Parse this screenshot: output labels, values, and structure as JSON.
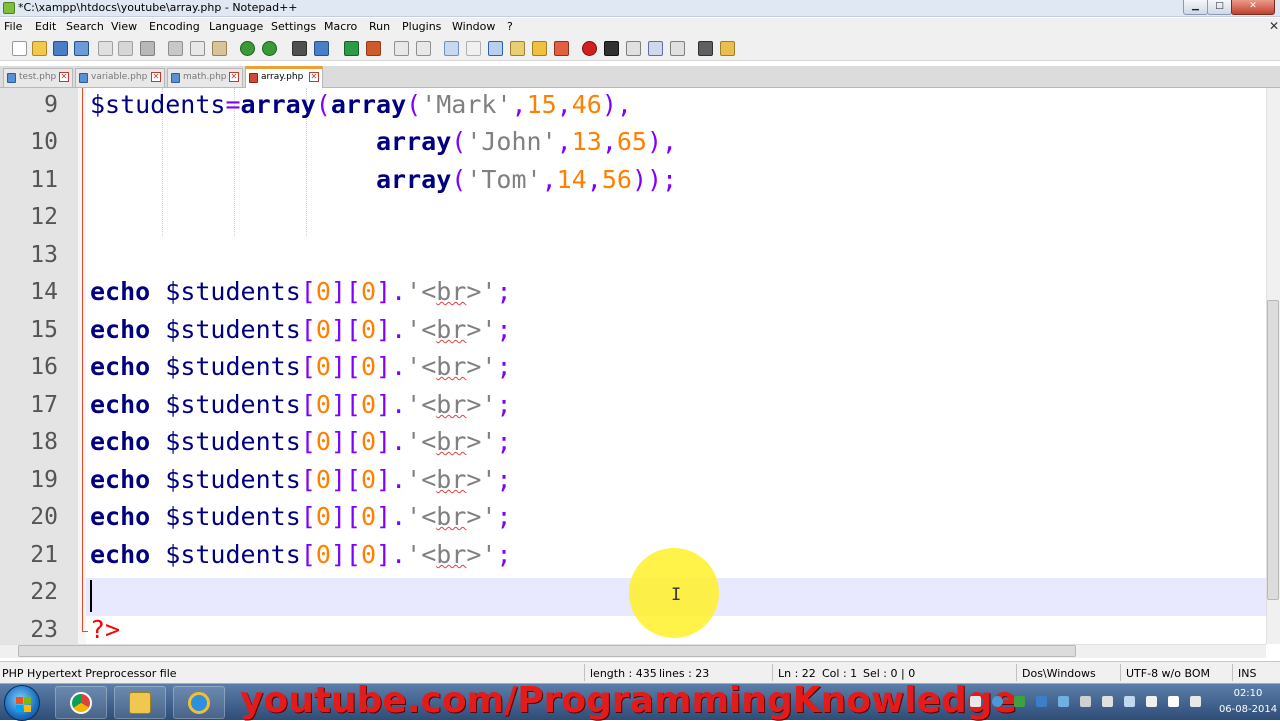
{
  "window": {
    "title": "*C:\\xampp\\htdocs\\youtube\\array.php - Notepad++",
    "min_glyph": "▁",
    "max_glyph": "□",
    "close_glyph": "✕"
  },
  "menu": {
    "items": [
      "File",
      "Edit",
      "Search",
      "View",
      "Encoding",
      "Language",
      "Settings",
      "Macro",
      "Run",
      "Plugins",
      "Window",
      "?"
    ],
    "close_glyph": "✕"
  },
  "tabs": [
    {
      "label": "test.php",
      "active": false
    },
    {
      "label": "variable.php",
      "active": false
    },
    {
      "label": "math.php",
      "active": false
    },
    {
      "label": "array.php",
      "active": true
    }
  ],
  "tab_close_glyph": "✕",
  "editor": {
    "line_numbers": [
      "9",
      "10",
      "11",
      "12",
      "13",
      "14",
      "15",
      "16",
      "17",
      "18",
      "19",
      "20",
      "21",
      "22",
      "23"
    ],
    "code": {
      "l9": {
        "var": "$students",
        "eq": "=",
        "fn1": "array",
        "p1": "(",
        "fn2": "array",
        "p2": "(",
        "s": "'Mark'",
        "c1": ",",
        "n1": "15",
        "c2": ",",
        "n2": "46",
        "p3": "),"
      },
      "l10": {
        "fn": "array",
        "p1": "(",
        "s": "'John'",
        "c1": ",",
        "n1": "13",
        "c2": ",",
        "n2": "65",
        "p2": "),"
      },
      "l11": {
        "fn": "array",
        "p1": "(",
        "s": "'Tom'",
        "c1": ",",
        "n1": "14",
        "c2": ",",
        "n2": "56",
        "p2": "));"
      },
      "echo_lines": [
        {
          "kw": "echo",
          "var": "$students",
          "b1": "[",
          "i1": "0",
          "b2": "][",
          "i2": "0",
          "b3": "].",
          "q1": "'<",
          "br": "br",
          "q2": ">'",
          "end": ";"
        },
        {
          "kw": "echo",
          "var": "$students",
          "b1": "[",
          "i1": "0",
          "b2": "][",
          "i2": "0",
          "b3": "].",
          "q1": "'<",
          "br": "br",
          "q2": ">'",
          "end": ";"
        },
        {
          "kw": "echo",
          "var": "$students",
          "b1": "[",
          "i1": "0",
          "b2": "][",
          "i2": "0",
          "b3": "].",
          "q1": "'<",
          "br": "br",
          "q2": ">'",
          "end": ";"
        },
        {
          "kw": "echo",
          "var": "$students",
          "b1": "[",
          "i1": "0",
          "b2": "][",
          "i2": "0",
          "b3": "].",
          "q1": "'<",
          "br": "br",
          "q2": ">'",
          "end": ";"
        },
        {
          "kw": "echo",
          "var": "$students",
          "b1": "[",
          "i1": "0",
          "b2": "][",
          "i2": "0",
          "b3": "].",
          "q1": "'<",
          "br": "br",
          "q2": ">'",
          "end": ";"
        },
        {
          "kw": "echo",
          "var": "$students",
          "b1": "[",
          "i1": "0",
          "b2": "][",
          "i2": "0",
          "b3": "].",
          "q1": "'<",
          "br": "br",
          "q2": ">'",
          "end": ";"
        },
        {
          "kw": "echo",
          "var": "$students",
          "b1": "[",
          "i1": "0",
          "b2": "][",
          "i2": "0",
          "b3": "].",
          "q1": "'<",
          "br": "br",
          "q2": ">'",
          "end": ";"
        },
        {
          "kw": "echo",
          "var": "$students",
          "b1": "[",
          "i1": "0",
          "b2": "][",
          "i2": "0",
          "b3": "].",
          "q1": "'<",
          "br": "br",
          "q2": ">'",
          "end": ";"
        }
      ],
      "l23": "?>"
    },
    "cursor_glyph": "I"
  },
  "status": {
    "file_type": "PHP Hypertext Preprocessor file",
    "length": "length : 435",
    "lines": "lines : 23",
    "ln": "Ln : 22",
    "col": "Col : 1",
    "sel": "Sel : 0 | 0",
    "eol": "Dos\\Windows",
    "encoding": "UTF-8 w/o BOM",
    "mode": "INS"
  },
  "taskbar": {
    "watermark": "youtube.com/ProgrammingKnowledge",
    "clock_time": "02:10",
    "clock_date": "06-08-2014"
  },
  "colors": {
    "keyword": "#000080",
    "operator": "#8000ff",
    "string": "#808080",
    "number": "#ff8000",
    "php_tag": "#ff0000",
    "watermark": "#e41b1b",
    "cursor_highlight": "#fff028"
  }
}
